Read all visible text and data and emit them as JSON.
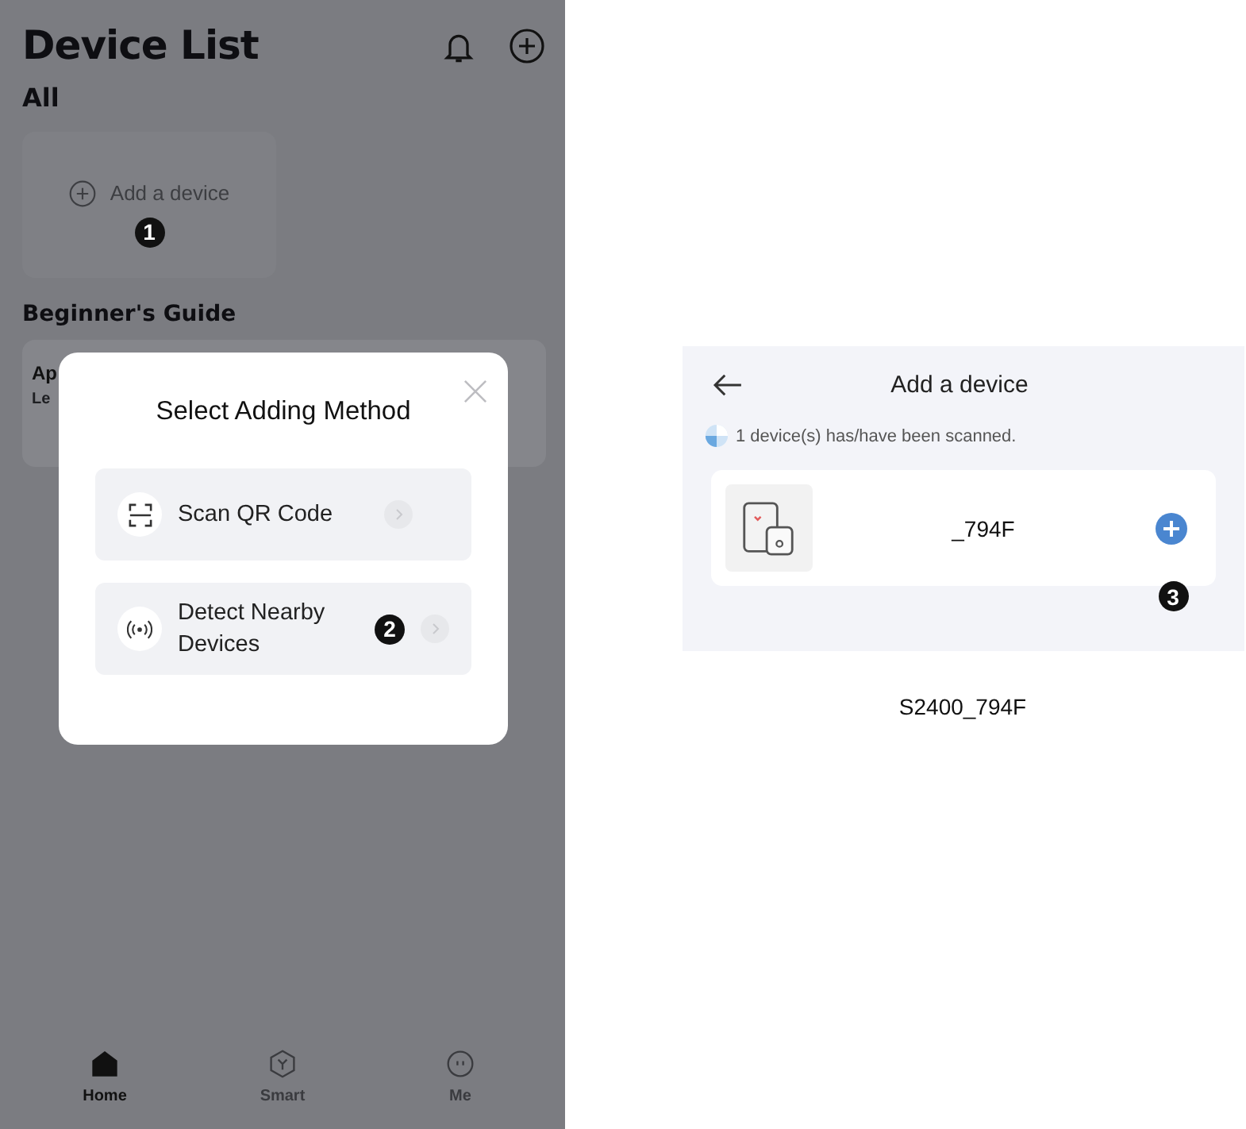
{
  "device_list": {
    "title": "Device List",
    "section": "All",
    "add_card": {
      "label": "Add a device",
      "step": "1"
    },
    "guide": {
      "title": "Beginner's Guide",
      "card_title": "Ap",
      "card_subtitle": "Le"
    }
  },
  "dialog": {
    "title": "Select Adding Method",
    "options": [
      {
        "kind": "qr",
        "label": "Scan QR Code"
      },
      {
        "kind": "nearby",
        "label": "Detect Nearby Devices",
        "step": "2"
      }
    ]
  },
  "tabs": [
    {
      "kind": "home",
      "label": "Home",
      "selected": true
    },
    {
      "kind": "smart",
      "label": "Smart",
      "selected": false
    },
    {
      "kind": "me",
      "label": "Me",
      "selected": false
    }
  ],
  "add_device": {
    "title": "Add a device",
    "status": "1 device(s) has/have been scanned.",
    "devices": [
      {
        "name": "_794F",
        "step": "3"
      }
    ],
    "caption": "S2400_794F"
  }
}
